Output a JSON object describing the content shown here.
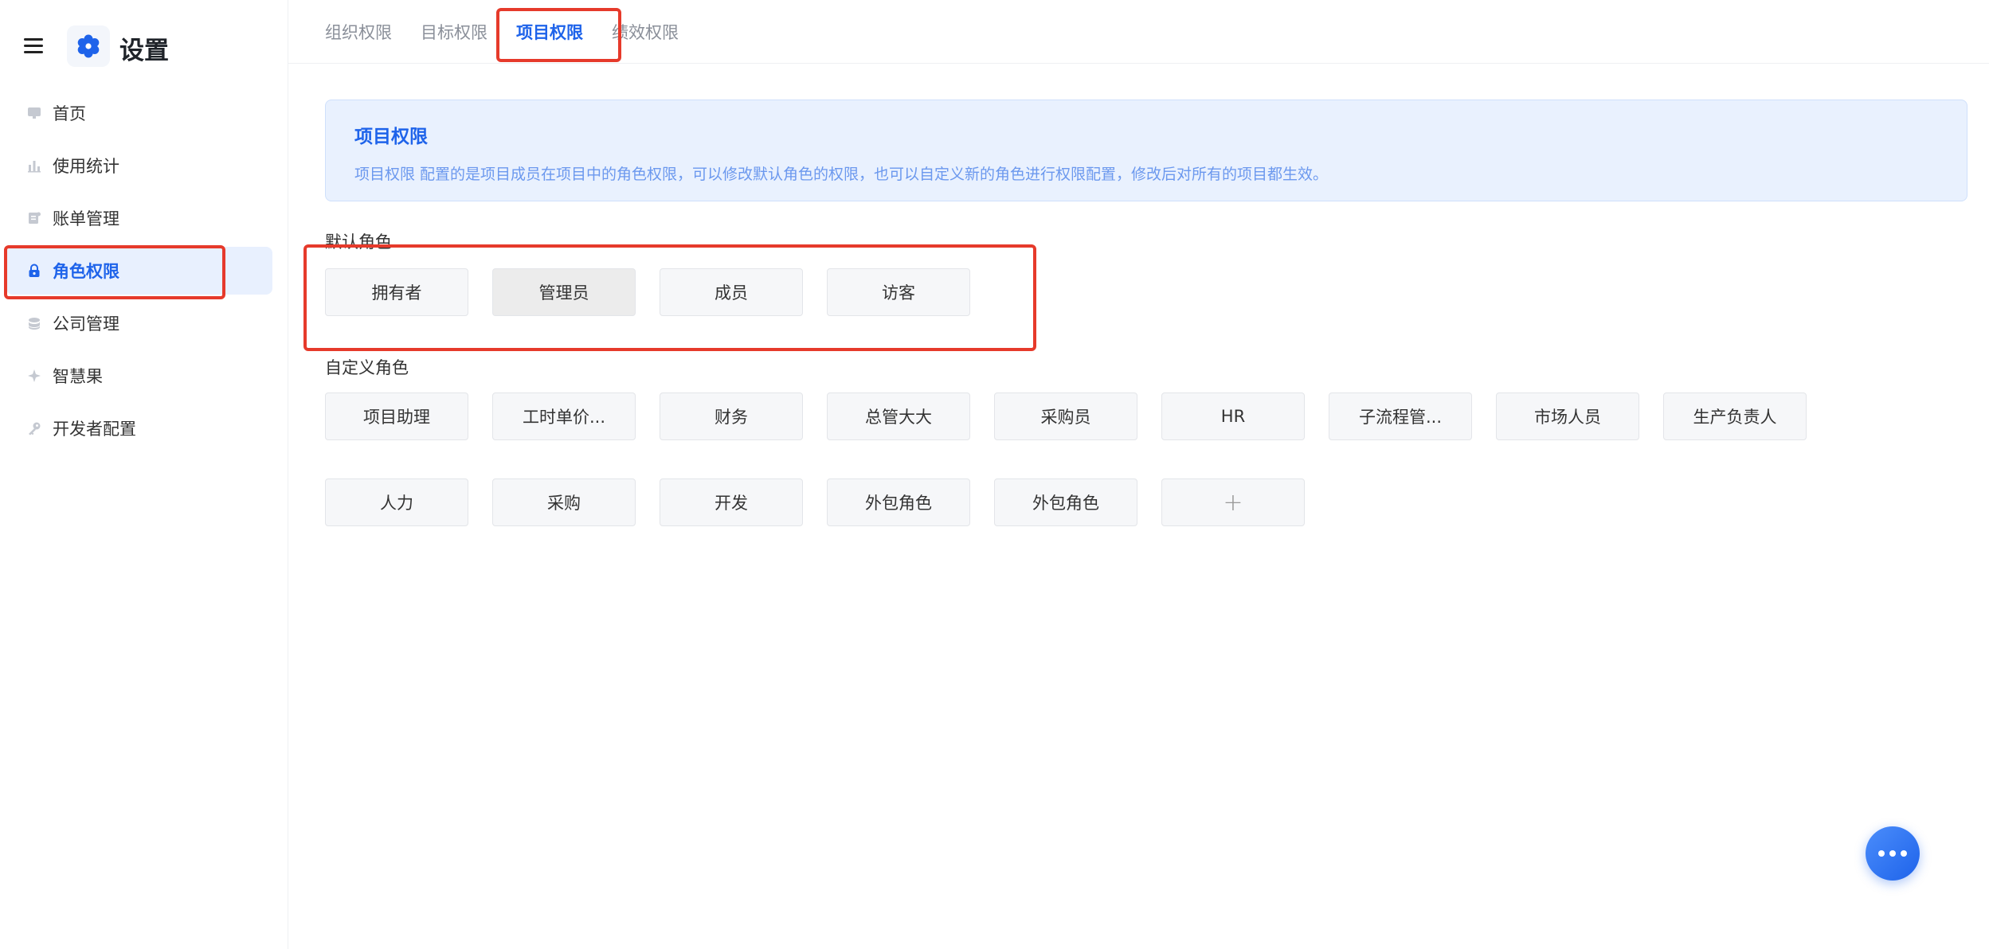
{
  "sidebar": {
    "title": "设置",
    "items": [
      {
        "label": "首页",
        "icon": "monitor-icon"
      },
      {
        "label": "使用统计",
        "icon": "bar-chart-icon"
      },
      {
        "label": "账单管理",
        "icon": "bill-icon"
      },
      {
        "label": "角色权限",
        "icon": "lock-icon",
        "active": true
      },
      {
        "label": "公司管理",
        "icon": "company-icon"
      },
      {
        "label": "智慧果",
        "icon": "sparkle-icon"
      },
      {
        "label": "开发者配置",
        "icon": "key-icon"
      }
    ]
  },
  "tabs": [
    {
      "label": "组织权限"
    },
    {
      "label": "目标权限"
    },
    {
      "label": "项目权限",
      "active": true
    },
    {
      "label": "绩效权限"
    }
  ],
  "banner": {
    "title": "项目权限",
    "description": "项目权限 配置的是项目成员在项目中的角色权限，可以修改默认角色的权限，也可以自定义新的角色进行权限配置，修改后对所有的项目都生效。"
  },
  "default_roles": {
    "label": "默认角色",
    "roles": [
      "拥有者",
      "管理员",
      "成员",
      "访客"
    ],
    "selected": "管理员"
  },
  "custom_roles": {
    "label": "自定义角色",
    "row1": [
      "项目助理",
      "工时单价...",
      "财务",
      "总管大大",
      "采购员",
      "HR",
      "子流程管...",
      "市场人员",
      "生产负责人"
    ],
    "row2": [
      "人力",
      "采购",
      "开发",
      "外包角色",
      "外包角色"
    ],
    "add_symbol": "+"
  },
  "colors": {
    "accent": "#1e63ea",
    "highlight_box": "#e63a2b",
    "banner_bg": "#e9f1fe"
  }
}
